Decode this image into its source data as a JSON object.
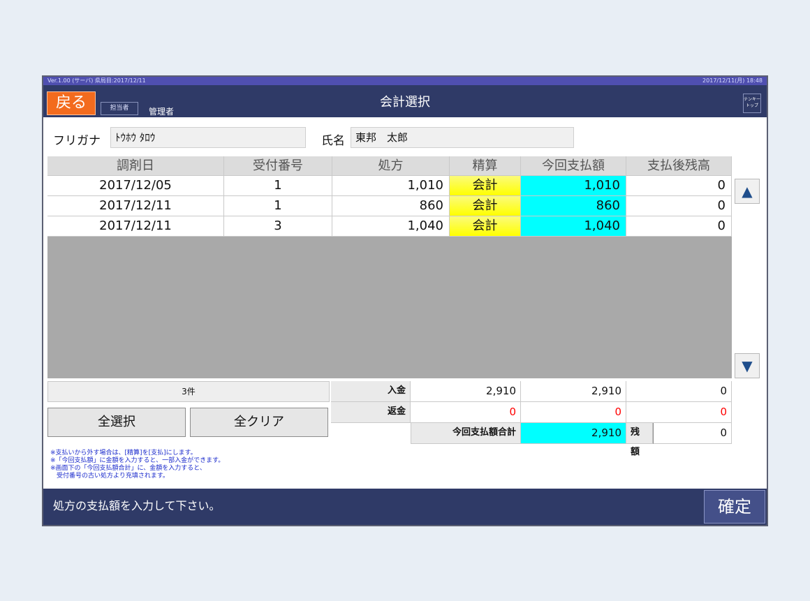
{
  "window": {
    "status_left": "Ver.1.00 (サーバ) 県局目:2017/12/11",
    "status_right": "2017/12/11(月) 18:48",
    "back_label": "戻る",
    "tanto_label": "担当者",
    "user_label": "管理者",
    "title": "会計選択",
    "tenkey_label": "テンキー\nトップ"
  },
  "patient": {
    "furigana_label": "フリガナ",
    "furigana_value": "ﾄｳﾎｳ ﾀﾛｳ",
    "name_label": "氏名",
    "name_value": "東邦　太郎"
  },
  "table": {
    "headers": [
      "調剤日",
      "受付番号",
      "処方",
      "精算",
      "今回支払額",
      "支払後残高"
    ],
    "rows": [
      {
        "date": "2017/12/05",
        "receipt": "1",
        "prescription": "1,010",
        "settle": "会計",
        "payment": "1,010",
        "balance": "0"
      },
      {
        "date": "2017/12/11",
        "receipt": "1",
        "prescription": "860",
        "settle": "会計",
        "payment": "860",
        "balance": "0"
      },
      {
        "date": "2017/12/11",
        "receipt": "3",
        "prescription": "1,040",
        "settle": "会計",
        "payment": "1,040",
        "balance": "0"
      }
    ]
  },
  "scroll": {
    "up_icon": "▲",
    "down_icon": "▼"
  },
  "summary": {
    "count": "3件",
    "deposit_label": "入金",
    "deposit_a": "2,910",
    "deposit_b": "2,910",
    "deposit_c": "0",
    "refund_label": "返金",
    "refund_a": "0",
    "refund_b": "0",
    "refund_c": "0",
    "total_label": "今回支払額合計",
    "total_value": "2,910",
    "remain_label": "残額",
    "remain_value": "0"
  },
  "buttons": {
    "select_all": "全選択",
    "clear_all": "全クリア",
    "confirm": "確定"
  },
  "notes": [
    "※支払いから外す場合は、[精算]を[支払]にします。",
    "※「今回支払額」に金額を入力すると、一部入金ができます。",
    "※画面下の「今回支払額合計」に、金額を入力すると、",
    "　受付番号の古い処方より充填されます。"
  ],
  "message": "処方の支払額を入力して下さい。",
  "colors": {
    "header_bar": "#2f3a67",
    "back": "#f36b1e",
    "settle": "#ffff00",
    "payment": "#00ffff"
  }
}
